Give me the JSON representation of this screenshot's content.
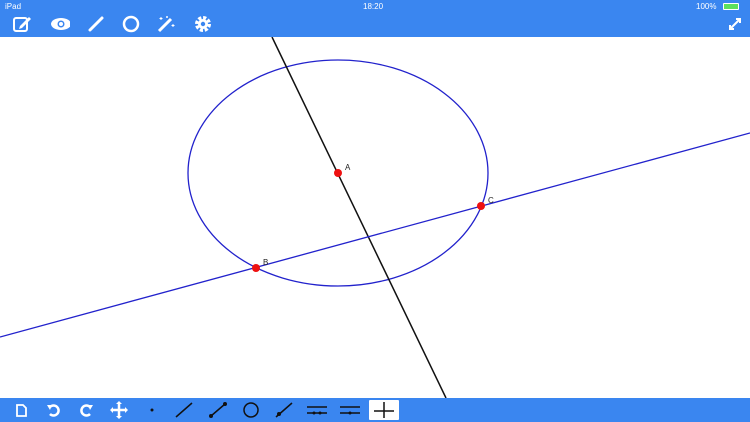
{
  "status_bar": {
    "device": "iPad",
    "time": "18:20",
    "battery": "100%"
  },
  "top_toolbar": {
    "icons": [
      "edit-icon",
      "eye-icon",
      "line-icon",
      "circle-icon",
      "magic-wand-icon",
      "gear-icon"
    ],
    "right_icon": "expand-icon"
  },
  "bottom_toolbar": {
    "icons": [
      "new-document-icon",
      "undo-icon",
      "redo-icon",
      "move-icon",
      "point-tool-icon",
      "line-tool-icon",
      "segment-tool-icon",
      "circle-tool-icon",
      "ray-tool-icon",
      "parallel-tool-icon",
      "parallel-line-tool-icon",
      "perpendicular-tool-icon"
    ],
    "active": "perpendicular-tool-icon"
  },
  "construction": {
    "points": [
      {
        "label": "A"
      },
      {
        "label": "B"
      },
      {
        "label": "C"
      }
    ]
  },
  "colors": {
    "accent": "#3a86f0",
    "circle": "#2222cc",
    "point": "#ee1111",
    "line": "#111111"
  }
}
